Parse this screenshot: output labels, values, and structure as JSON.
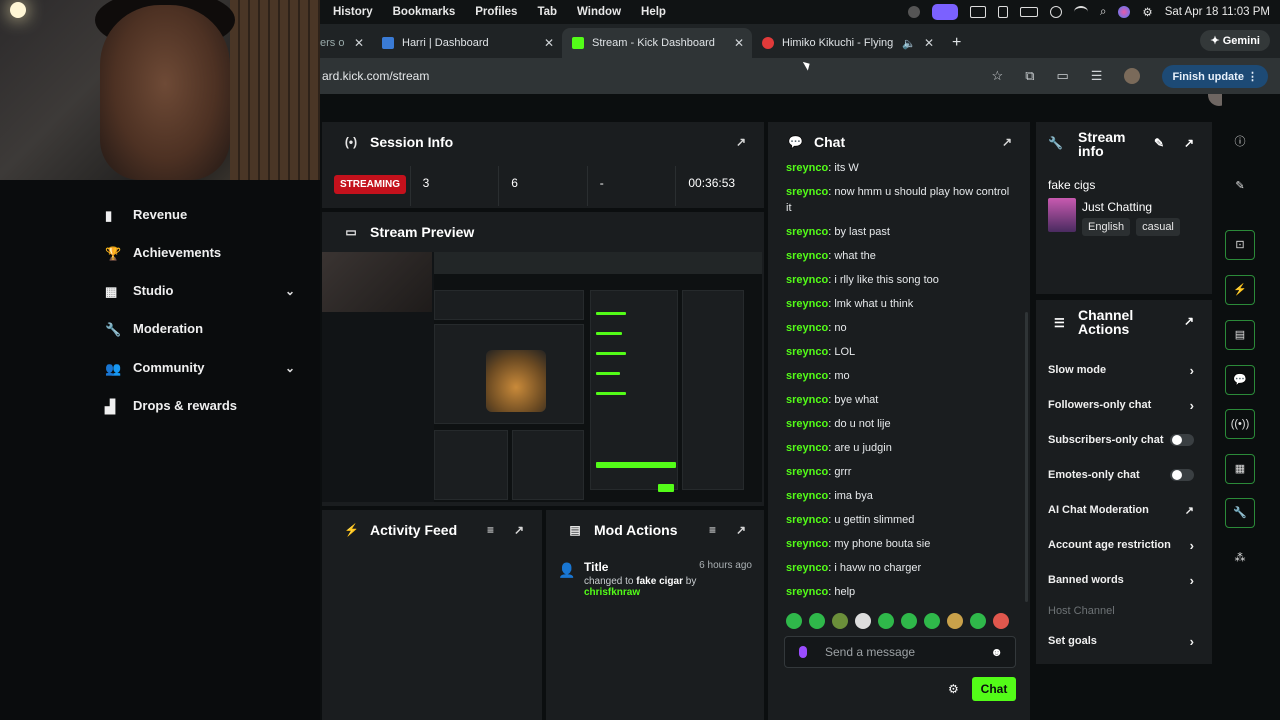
{
  "menubar": {
    "items": [
      "History",
      "Bookmarks",
      "Profiles",
      "Tab",
      "Window",
      "Help"
    ],
    "clock": "Sat Apr 18  11:03 PM"
  },
  "tabs": [
    {
      "label": "ers o",
      "favicon_color": "#1f2325"
    },
    {
      "label": "Harri | Dashboard",
      "favicon_color": "#3a7bd5"
    },
    {
      "label": "Stream - Kick Dashboard",
      "favicon_color": "#53fc18"
    },
    {
      "label": "Himiko Kikuchi - Flying Be",
      "favicon_color": "#e03a3a"
    }
  ],
  "gemini_label": "Gemini",
  "address": {
    "url": "ard.kick.com/stream",
    "finish_update": "Finish update"
  },
  "sidebar": {
    "items": [
      {
        "label": "Revenue"
      },
      {
        "label": "Achievements"
      },
      {
        "label": "Studio",
        "chevron": "⌄"
      },
      {
        "label": "Moderation"
      },
      {
        "label": "Community",
        "chevron": "⌄"
      },
      {
        "label": "Drops & rewards"
      }
    ]
  },
  "session": {
    "title": "Session Info",
    "status": "STREAMING",
    "viewers": "3",
    "followers": "6",
    "subs": "-",
    "time": "00:36:53"
  },
  "preview": {
    "title": "Stream Preview"
  },
  "activity": {
    "title": "Activity Feed"
  },
  "mod": {
    "title": "Mod Actions",
    "entry_title": "Title",
    "entry_time": "6 hours ago",
    "entry_changed": "changed to",
    "entry_value": "fake cigar",
    "entry_by": "by",
    "entry_user": "chrisfknraw"
  },
  "chat": {
    "title": "Chat",
    "messages": [
      {
        "user": "sreynco",
        "text": "its W"
      },
      {
        "user": "sreynco",
        "text": "now hmm u should play how control it"
      },
      {
        "user": "sreynco",
        "text": "by last past"
      },
      {
        "user": "sreynco",
        "text": "what the"
      },
      {
        "user": "sreynco",
        "text": "i rlly like this song too"
      },
      {
        "user": "sreynco",
        "text": "lmk what u think"
      },
      {
        "user": "sreynco",
        "text": "no"
      },
      {
        "user": "sreynco",
        "text": "LOL"
      },
      {
        "user": "sreynco",
        "text": "mo"
      },
      {
        "user": "sreynco",
        "text": "bye what"
      },
      {
        "user": "sreynco",
        "text": "do u not lije"
      },
      {
        "user": "sreynco",
        "text": "are u judgin"
      },
      {
        "user": "sreynco",
        "text": "grrr"
      },
      {
        "user": "sreynco",
        "text": "ima bya"
      },
      {
        "user": "sreynco",
        "text": "u gettin slimmed"
      },
      {
        "user": "sreynco",
        "text": "my phone bouta sie"
      },
      {
        "user": "sreynco",
        "text": "i havw no charger"
      },
      {
        "user": "sreynco",
        "text": "help"
      }
    ],
    "placeholder": "Send a message",
    "send_label": "Chat"
  },
  "stream_info": {
    "title": "Stream info",
    "stream_title": "fake cigs",
    "category": "Just Chatting",
    "tags": [
      "English",
      "casual"
    ]
  },
  "channel_actions": {
    "title": "Channel Actions",
    "rows": [
      {
        "label": "Slow mode",
        "kind": "arrow"
      },
      {
        "label": "Followers-only chat",
        "kind": "arrow"
      },
      {
        "label": "Subscribers-only chat",
        "kind": "toggle"
      },
      {
        "label": "Emotes-only chat",
        "kind": "toggle"
      },
      {
        "label": "AI Chat Moderation",
        "kind": "external"
      },
      {
        "label": "Account age restriction",
        "kind": "arrow"
      },
      {
        "label": "Banned words",
        "kind": "arrow"
      },
      {
        "label": "Host Channel",
        "kind": "disabled"
      },
      {
        "label": "Set goals",
        "kind": "arrow"
      }
    ]
  },
  "colors": {
    "accent": "#53fc18",
    "streaming": "#c4111c",
    "panel": "#1a1d1f"
  }
}
